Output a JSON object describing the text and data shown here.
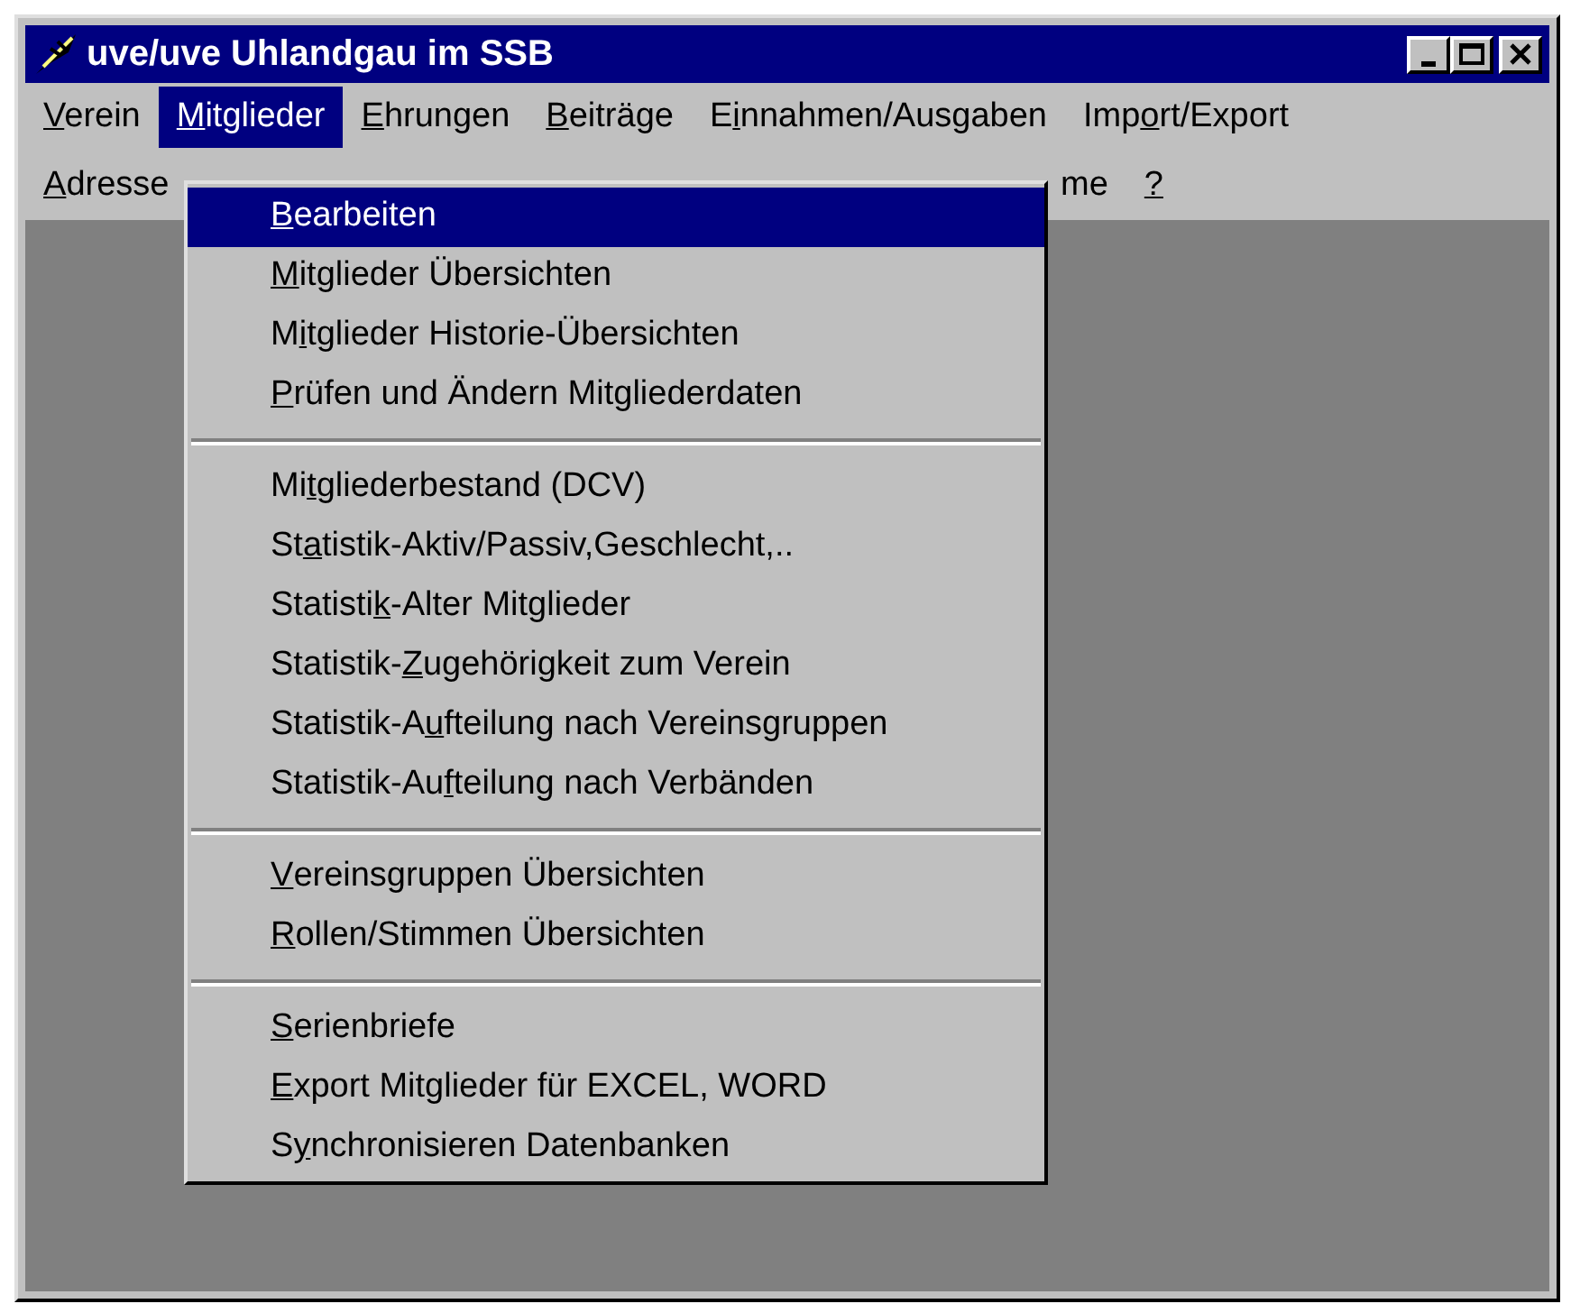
{
  "window": {
    "title": "uve/uve Uhlandgau im SSB"
  },
  "menubar": {
    "items": [
      {
        "label": {
          "key": "V",
          "post": "erein"
        },
        "selected": false
      },
      {
        "label": {
          "key": "M",
          "post": "itglieder"
        },
        "selected": true
      },
      {
        "label": {
          "key": "E",
          "post": "hrungen"
        },
        "selected": false
      },
      {
        "label": {
          "key": "B",
          "post": "eiträge"
        },
        "selected": false
      },
      {
        "label": {
          "pre": "E",
          "key": "i",
          "post": "nnahmen/Ausgaben"
        },
        "selected": false
      },
      {
        "label": {
          "pre": "Imp",
          "key": "o",
          "post": "rt/Export"
        },
        "selected": false
      },
      {
        "label": {
          "key": "A",
          "post": "dresse"
        },
        "selected": false
      },
      {
        "label": {
          "pre": "me"
        },
        "selected": false
      },
      {
        "label": {
          "key": "?"
        },
        "selected": false
      }
    ]
  },
  "dropdown": {
    "groups": [
      [
        {
          "label": {
            "key": "B",
            "post": "earbeiten"
          },
          "selected": true
        },
        {
          "label": {
            "key": "M",
            "post": "itglieder Übersichten"
          },
          "selected": false
        },
        {
          "label": {
            "pre": "M",
            "key": "i",
            "post": "tglieder Historie-Übersichten"
          },
          "selected": false
        },
        {
          "label": {
            "key": "P",
            "post": "rüfen und Ändern Mitgliederdaten"
          },
          "selected": false
        }
      ],
      [
        {
          "label": {
            "pre": "Mi",
            "key": "t",
            "post": "gliederbestand (DCV)"
          },
          "selected": false
        },
        {
          "label": {
            "pre": "St",
            "key": "a",
            "post": "tistik-Aktiv/Passiv,Geschlecht,.."
          },
          "selected": false
        },
        {
          "label": {
            "pre": "Statisti",
            "key": "k",
            "post": "-Alter Mitglieder"
          },
          "selected": false
        },
        {
          "label": {
            "pre": "Statistik-",
            "key": "Z",
            "post": "ugehörigkeit zum Verein"
          },
          "selected": false
        },
        {
          "label": {
            "pre": "Statistik-A",
            "key": "u",
            "post": "fteilung nach Vereinsgruppen"
          },
          "selected": false
        },
        {
          "label": {
            "pre": "Statistik-Au",
            "key": "f",
            "post": "teilung nach Verbänden"
          },
          "selected": false
        }
      ],
      [
        {
          "label": {
            "key": "V",
            "post": "ereinsgruppen Übersichten"
          },
          "selected": false
        },
        {
          "label": {
            "key": "R",
            "post": "ollen/Stimmen Übersichten"
          },
          "selected": false
        }
      ],
      [
        {
          "label": {
            "key": "S",
            "post": "erienbriefe"
          },
          "selected": false
        },
        {
          "label": {
            "key": "E",
            "post": "xport Mitglieder für EXCEL, WORD"
          },
          "selected": false
        },
        {
          "label": {
            "pre": "S",
            "key": "y",
            "post": "nchronisieren Datenbanken"
          },
          "selected": false
        }
      ]
    ]
  }
}
